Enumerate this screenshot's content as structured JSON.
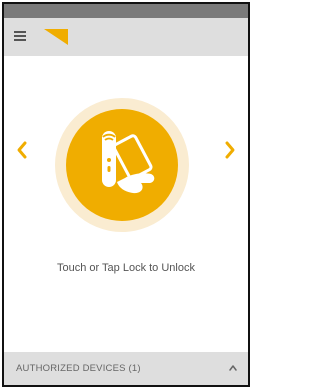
{
  "colors": {
    "accent": "#f0ad00",
    "accent_light": "#faecd1",
    "status_bar": "#7a7a7a",
    "app_bar": "#dedede"
  },
  "header": {
    "menu_icon": "hamburger-menu-icon",
    "logo_icon": "yellow-triangle-logo"
  },
  "main": {
    "prev_icon": "chevron-left-icon",
    "next_icon": "chevron-right-icon",
    "lock_icon": "hand-tapping-phone-on-lock-icon",
    "instruction": "Touch or Tap Lock to Unlock"
  },
  "footer": {
    "label": "AUTHORIZED DEVICES (1)",
    "toggle_icon": "chevron-up-icon"
  }
}
